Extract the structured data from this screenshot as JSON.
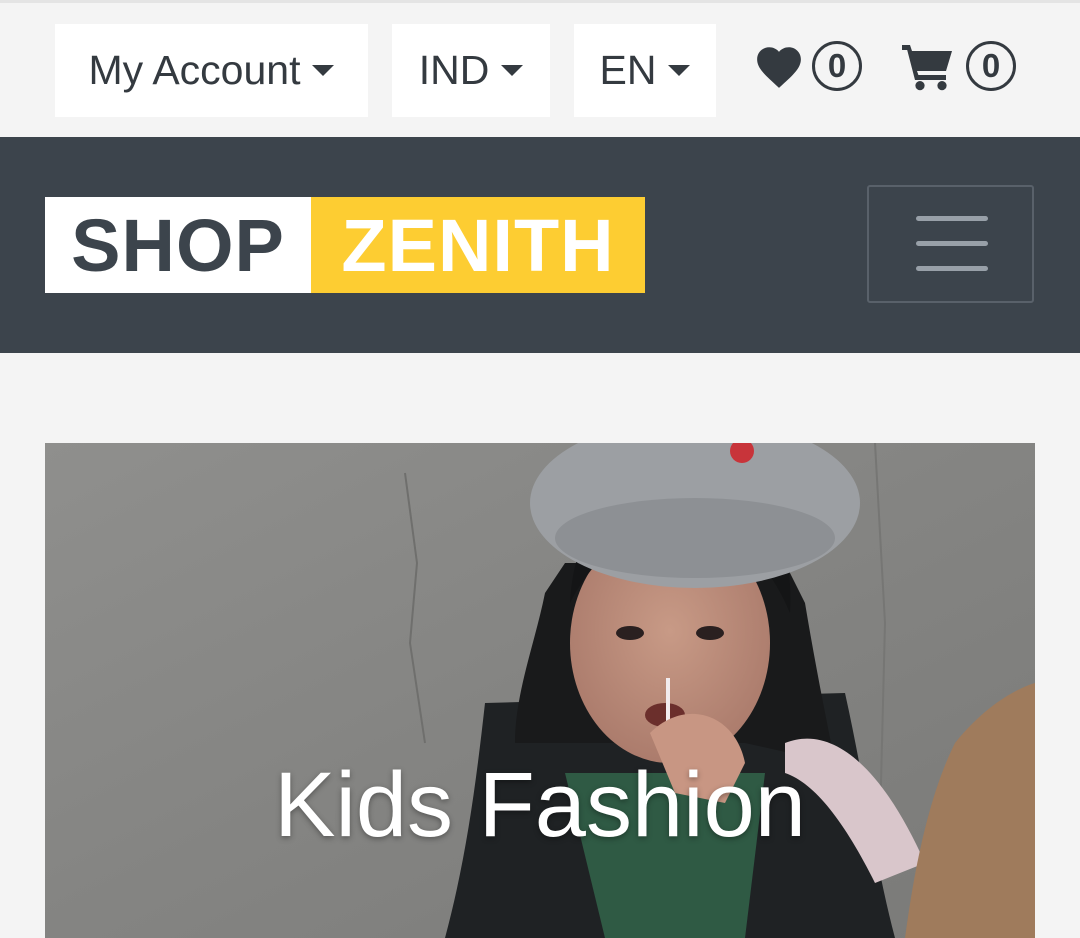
{
  "topbar": {
    "account_label": "My Account",
    "currency_label": "IND",
    "language_label": "EN",
    "wishlist_count": "0",
    "cart_count": "0"
  },
  "brand": {
    "part1": "SHOP",
    "part2": "ZENITH",
    "accent_color": "#fdcd32",
    "dark_color": "#3c444c"
  },
  "hero": {
    "title": "Kids Fashion"
  },
  "icons": {
    "wishlist": "heart-icon",
    "cart": "cart-icon",
    "menu": "menu-icon"
  }
}
